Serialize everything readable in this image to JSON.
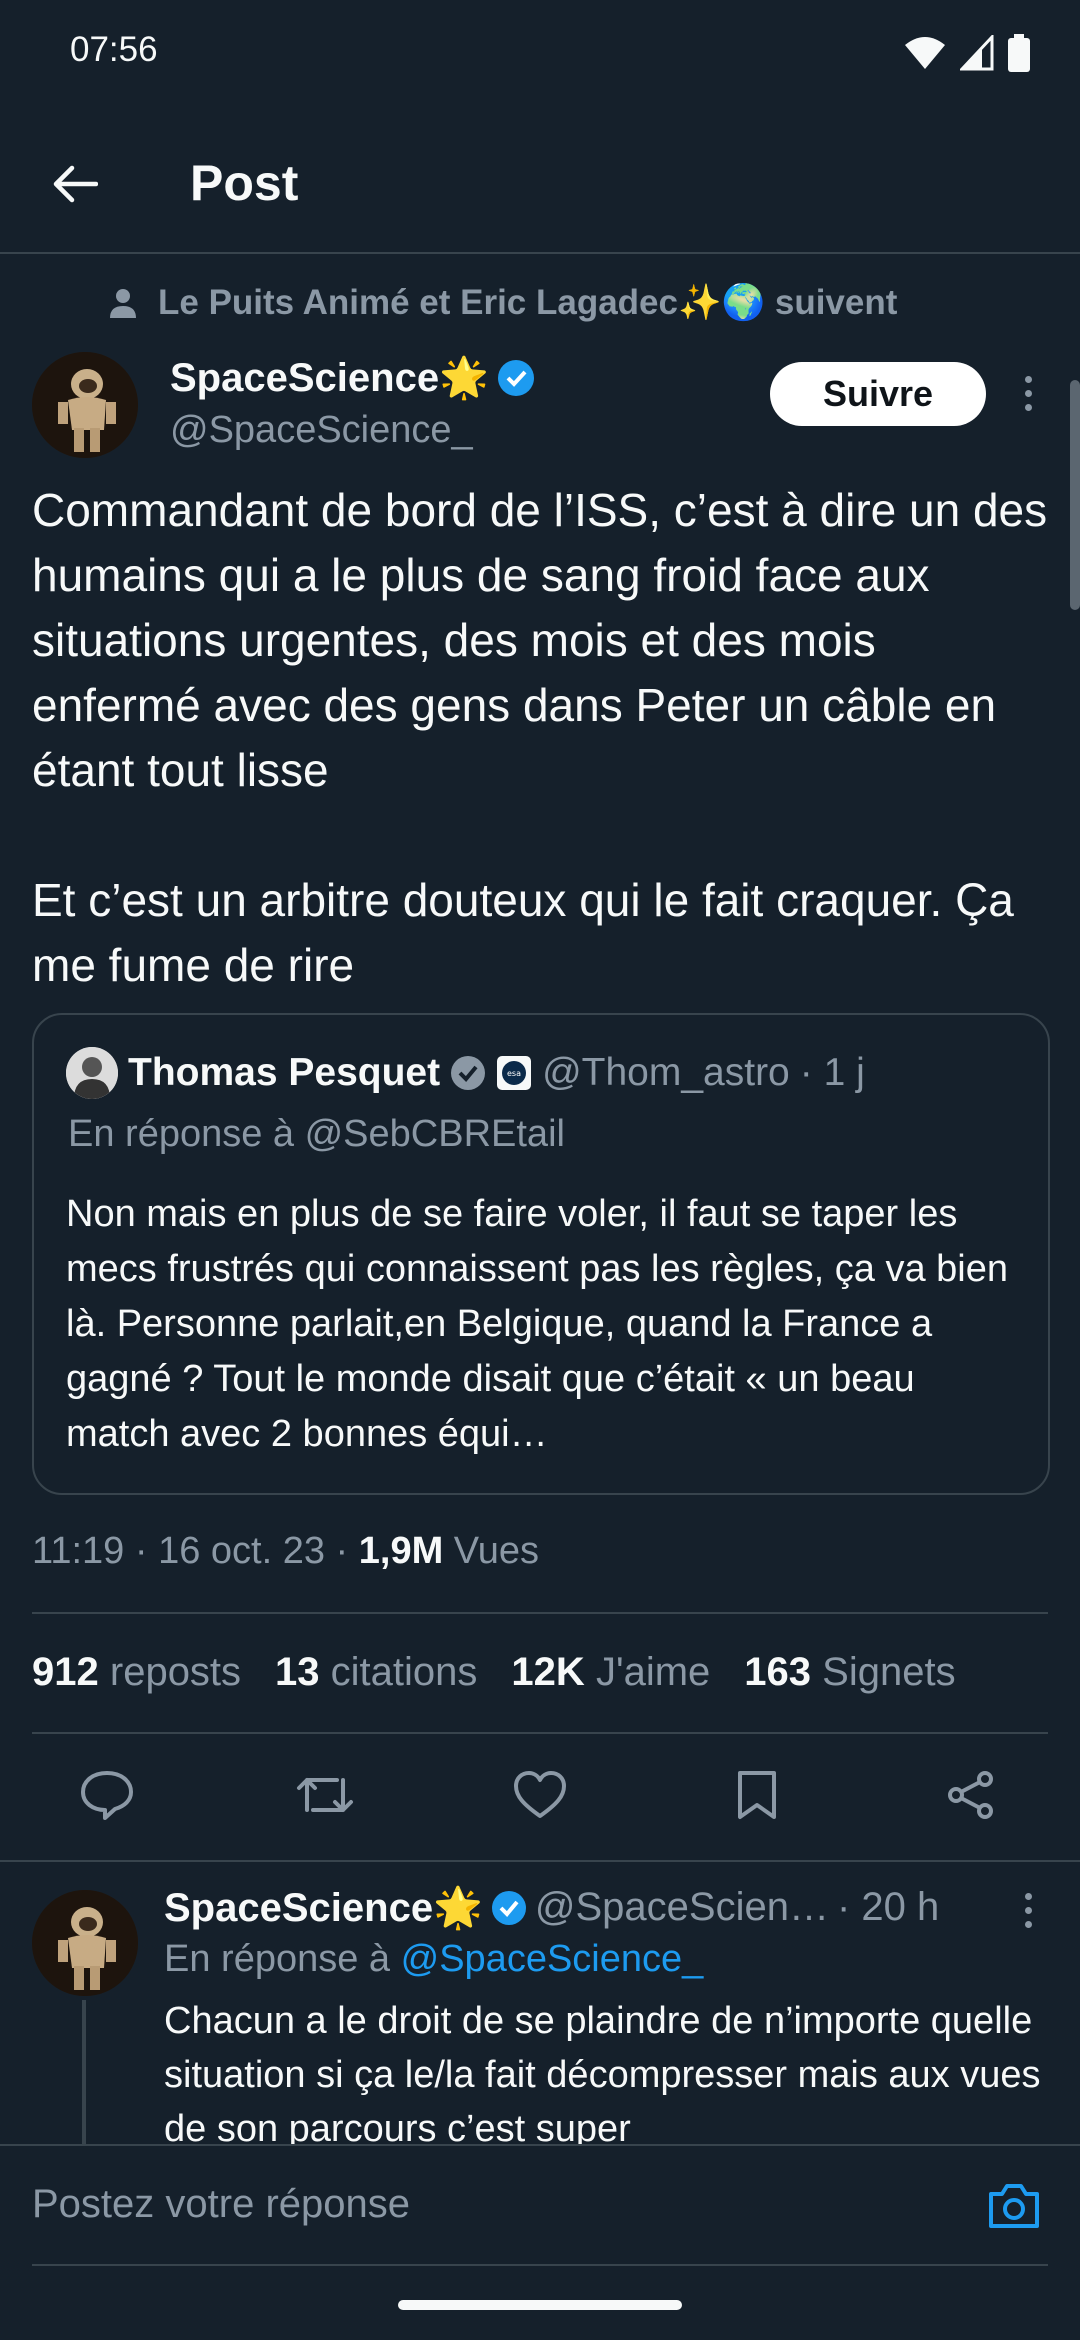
{
  "status_bar": {
    "time": "07:56"
  },
  "header": {
    "title": "Post"
  },
  "social_context": "Le Puits Animé et Eric Lagadec✨🌍 suivent",
  "post": {
    "author_name": "SpaceScience🌟",
    "author_handle": "@SpaceScience_",
    "follow_label": "Suivre",
    "text": "Commandant de bord de l’ISS, c’est à dire un des humains qui a le plus de sang froid face aux situations urgentes, des mois et des mois enfermé avec des gens dans Peter un câble en étant tout lisse\n\nEt c’est un arbitre douteux qui le fait craquer. Ça me fume de rire",
    "quote": {
      "author_name": "Thomas Pesquet",
      "author_handle": "@Thom_astro",
      "time": "· 1 j",
      "reply_context": "En réponse à @SebCBREtail",
      "text": "Non mais en plus de se faire voler, il faut se taper les mecs frustrés qui connaissent pas les règles, ça va bien là. Personne parlait,en Belgique, quand la France a gagné ? Tout le monde disait que c’était « un beau match avec 2 bonnes équi…"
    },
    "meta": {
      "time": "11:19",
      "date": "16 oct. 23",
      "views_count": "1,9M",
      "views_label": "Vues"
    },
    "stats": [
      {
        "value": "912",
        "label": "reposts"
      },
      {
        "value": "13",
        "label": "citations"
      },
      {
        "value": "12K",
        "label": "J'aime"
      },
      {
        "value": "163",
        "label": "Signets"
      }
    ]
  },
  "reply": {
    "author_name": "SpaceScience🌟",
    "author_handle": "@SpaceScien…",
    "time": "· 20 h",
    "reply_prefix": "En réponse à",
    "reply_link": "@SpaceScience_",
    "text": "Chacun a le droit de se plaindre de n’importe quelle situation si ça le/la fait décompresser mais aux vues de son parcours c’est super"
  },
  "composer": {
    "placeholder": "Postez votre réponse"
  },
  "colors": {
    "background": "#15202b",
    "text": "#f7f9f9",
    "muted": "#8b98a5",
    "accent": "#1d9bf0",
    "border": "#38444d"
  }
}
